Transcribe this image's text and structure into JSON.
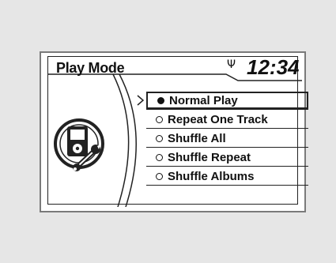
{
  "header": {
    "title": "Play Mode",
    "usb_symbol": "Ψ",
    "clock": "12:34"
  },
  "menu": {
    "items": [
      {
        "label": "Normal Play",
        "selected": true
      },
      {
        "label": "Repeat One Track",
        "selected": false
      },
      {
        "label": "Shuffle All",
        "selected": false
      },
      {
        "label": "Shuffle Repeat",
        "selected": false
      },
      {
        "label": "Shuffle Albums",
        "selected": false
      }
    ]
  },
  "icons": {
    "device": "ipod-wrench-icon",
    "usb": "usb-icon",
    "pointer": "selection-arrow-icon",
    "radio_on": "radio-filled-icon",
    "radio_off": "radio-empty-icon"
  },
  "colors": {
    "background": "#e6e6e6",
    "screen": "#ffffff",
    "ink": "#111111"
  }
}
